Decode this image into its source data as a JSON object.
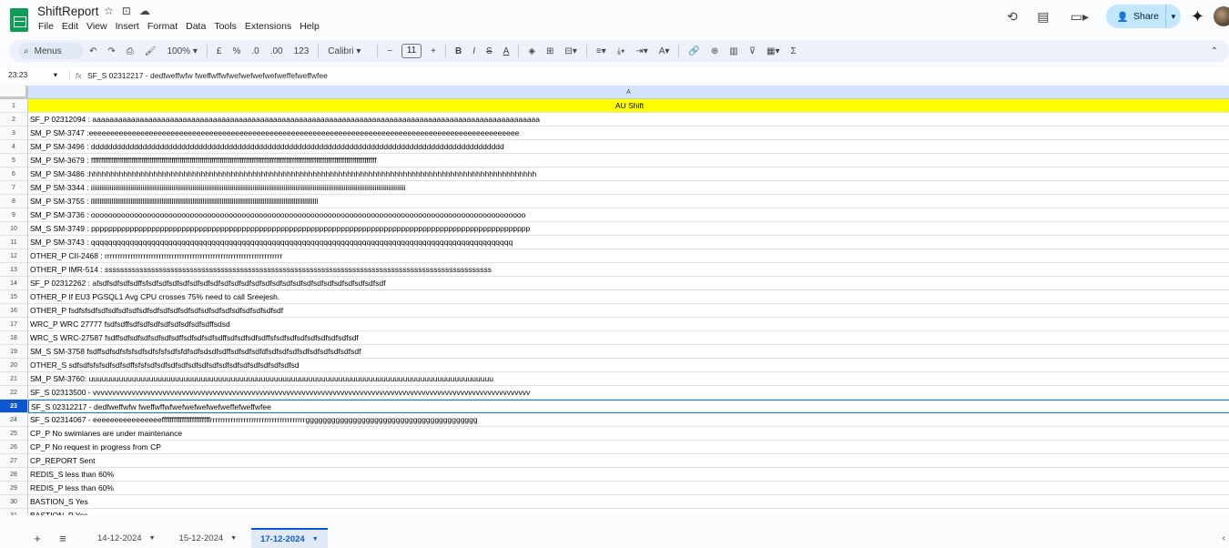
{
  "app": {
    "title": "ShiftReport",
    "menu": [
      "File",
      "Edit",
      "View",
      "Insert",
      "Format",
      "Data",
      "Tools",
      "Extensions",
      "Help"
    ],
    "share_label": "Share"
  },
  "toolbar": {
    "menus_label": "Menus",
    "zoom": "100%",
    "currency": "£",
    "percent": "%",
    "dec_decrease": ".0",
    "dec_increase": ".00",
    "number_format": "123",
    "font": "Calibri",
    "font_size": "11",
    "minus": "−",
    "plus": "+"
  },
  "formula_bar": {
    "cell_ref": "23:23",
    "fx": "fx",
    "content": "SF_S 02312217 - dedfweffwfw fweffwffwfwefwefwefwefweffefweffwfee"
  },
  "grid": {
    "column_letter": "A",
    "selected_row": 23,
    "rows": [
      {
        "n": "1",
        "text": "AU Shift"
      },
      {
        "n": "2",
        "text": "SF_P 02312094 : aaaaaaaaaaaaaaaaaaaaaaaaaaaaaaaaaaaaaaaaaaaaaaaaaaaaaaaaaaaaaaaaaaaaaaaaaaaaaaaaaaaaaaaaaaaaaaaaaaaaaaaa"
      },
      {
        "n": "3",
        "text": "SM_P SM-3747 :eeeeeeeeeeeeeeeeeeeeeeeeeeeeeeeeeeeeeeeeeeeeeeeeeeeeeeeeeeeeeeeeeeeeeeeeeeeeeeeeeeeeeeeeeeeeeeeeeeee"
      },
      {
        "n": "4",
        "text": "SM_P SM-3496 : dddddddddddddddddddddddddddddddddddddddddddddddddddddddddddddddddddddddddddddddddddddddddddddddd"
      },
      {
        "n": "5",
        "text": "SM_P SM-3679 : ffffffffffffffffffffffffffffffffffffffffffffffffffffffffffffffffffffffffffffffffffffffffffffffffffffffffffffffffffffffffffffffffffffffffffffff"
      },
      {
        "n": "6",
        "text": "SM_P SM-3486 :hhhhhhhhhhhhhhhhhhhhhhhhhhhhhhhhhhhhhhhhhhhhhhhhhhhhhhhhhhhhhhhhhhhhhhhhhhhhhhhhhhhhhhhhhhhhhhhhhhhhhhhh"
      },
      {
        "n": "7",
        "text": "SM_P SM-3344 : iiiiiiiiiiiiiiiiiiiiiiiiiiiiiiiiiiiiiiiiiiiiiiiiiiiiiiiiiiiiiiiiiiiiiiiiiiiiiiiiiiiiiiiiiiiiiiiiiiiiiiiiiiiiiiiiiiiiiiiiiiiiiiiiiiiiiiiiiiiiiiiiiiiiiiiiiiiiiiiiiiiiiiiiiiiiiiiiiiiiiii"
      },
      {
        "n": "8",
        "text": "SM_P SM-3755 : llllllllllllllllllllllllllllllllllllllllllllllllllllllllllllllllllllllllllllllllllllllllllllllllllllllllllllllllllllllllllllllllllll"
      },
      {
        "n": "9",
        "text": "SM_P SM-3736 : ooooooooooooooooooooooooooooooooooooooooooooooooooooooooooooooooooooooooooooooooooooooooooooooooooooo"
      },
      {
        "n": "10",
        "text": "SM_S SM-3749 : pppppppppppppppppppppppppppppppppppppppppppppppppppppppppppppppppppppppppppppppppppppppppppppppppppppp"
      },
      {
        "n": "11",
        "text": "SM_P SM-3743 : qqqqqqqqqqqqqqqqqqqqqqqqqqqqqqqqqqqqqqqqqqqqqqqqqqqqqqqqqqqqqqqqqqqqqqqqqqqqqqqqqqqqqqqqqqqqqqqqqq"
      },
      {
        "n": "12",
        "text": "OTHER_P CII-2468 : rrrrrrrrrrrrrrrrrrrrrrrrrrrrrrrrrrrrrrrrrrrrrrrrrrrrrrrrrrrrrrrrrrrrr"
      },
      {
        "n": "13",
        "text": "OTHER_P IMR-514 : ssssssssssssssssssssssssssssssssssssssssssssssssssssssssssssssssssssssssssssssssssssssssssssssssssss"
      },
      {
        "n": "14",
        "text": "SF_P 02312262 : afsdfsdfsdfsdffsfsdfsdfsdfsdfsdfsdfsdfsdfsdfsdfsdfsdfsdfsdfsdfsdfsdfsdfsdfsdfsdfsdfsdf"
      },
      {
        "n": "15",
        "text": "OTHER_P If EU3 PGSQL1 Avg CPU crosses 75% need to call Sreejesh."
      },
      {
        "n": "16",
        "text": "OTHER_P fsdfsfsdfsdfsdfsdfsdfsdfsdfsdfsdfsdfsdfsdfsdfsdfsdfsdfsdfsdfsdf"
      },
      {
        "n": "17",
        "text": "WRC_P WRC 27777 fsdfsdffsdfsdfsdfsdfsdfsdfsdfsdffsdsd"
      },
      {
        "n": "18",
        "text": "WRC_S WRC-27587 fsdffsdfsdfsdfsdfsdfsdffsdfsdfsdfsdffsdfsdfsdfsdffsfsdfsdfsdfsdfsdfsdfsdfsdf"
      },
      {
        "n": "19",
        "text": "SM_S SM-3758 fsdffsdfsdfsfsfsdfsdfsfsfsdfsfdfsdfsdsdfsdffsdfsdfsdfdfsdfsdfsdfsdfsdfsdfsdfsdfsdf"
      },
      {
        "n": "20",
        "text": "OTHER_S sdfsdfsfsfsdfsdfsdffsfsfsdfsdfsdfsdfsdfsdfsdfsdfsdfsdfsdfsdfsdfsdfsd"
      },
      {
        "n": "21",
        "text": "SM_P SM-3760: uuuuuuuuuuuuuuuuuuuuuuuuuuuuuuuuuuuuuuuuuuuuuuuuuuuuuuuuuuuuuuuuuuuuuuuuuuuuuuuuuuuuuuuuuuuuuu"
      },
      {
        "n": "22",
        "text": "SF_S 02313500 - vvvvvvvvvvvvvvvvvvvvvvvvvvvvvvvvvvvvvvvvvvvvvvvvvvvvvvvvvvvvvvvvvvvvvvvvvvvvvvvvvvvvvvvvvvvvvvvvvvvvvvvvvvvvvvvvv"
      },
      {
        "n": "23",
        "text": "SF_S 02312217 - dedfweffwfw fweffwffwfwefwefwefwefweffefweffwfee"
      },
      {
        "n": "24",
        "text": "SF_S 02314067 - eeeeeeeeeeeeeeeeffffffffffffffffffffffffrrrrrrrrrrrrrrrrrrrrrrrrrrrrrrrrrrrrrgggggggggggggggggggggggggggggggggggggggg"
      },
      {
        "n": "25",
        "text": "CP_P No swimlanes are under maintenance"
      },
      {
        "n": "26",
        "text": "CP_P No request in progress from CP"
      },
      {
        "n": "27",
        "text": "CP_REPORT Sent"
      },
      {
        "n": "28",
        "text": "REDIS_S less than 60%"
      },
      {
        "n": "29",
        "text": "REDIS_P less than 60%"
      },
      {
        "n": "30",
        "text": "BASTION_S Yes"
      },
      {
        "n": "31",
        "text": "BASTION_P Yes"
      }
    ]
  },
  "sheets": {
    "tabs": [
      {
        "label": "14-12-2024"
      },
      {
        "label": "15-12-2024"
      },
      {
        "label": "17-12-2024"
      }
    ],
    "active_index": 2
  },
  "colors": {
    "header_fill": "#ffff00",
    "accent": "#0b57d0",
    "share_bg": "#c2e7ff"
  }
}
